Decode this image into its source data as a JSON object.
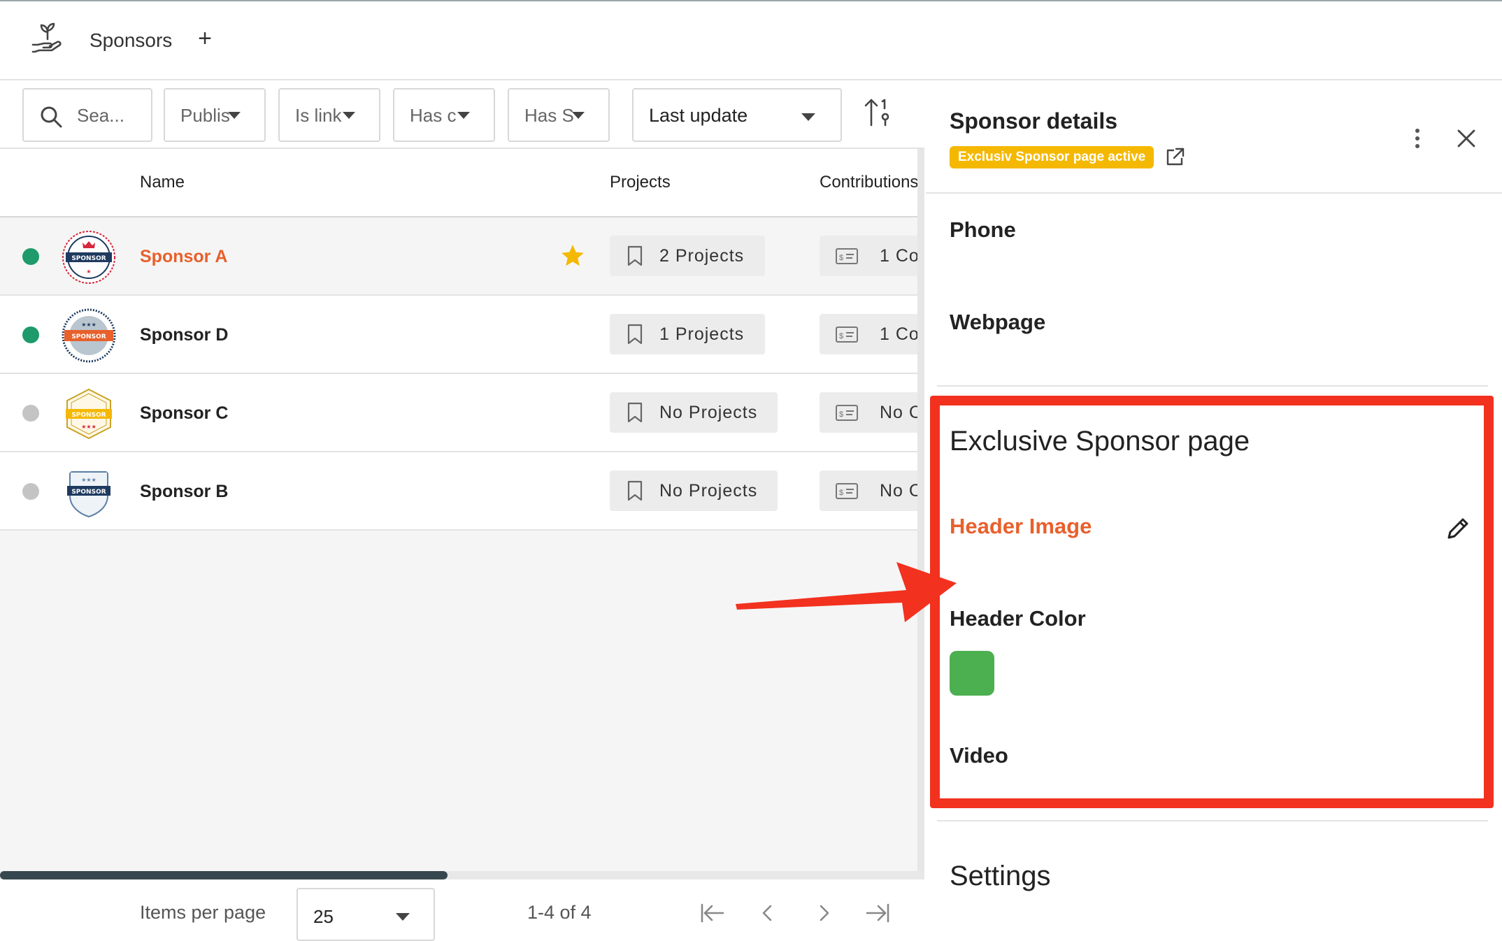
{
  "header": {
    "title": "Sponsors",
    "add_label": "+"
  },
  "filters": {
    "search_placeholder": "Sea...",
    "published": "Publis",
    "is_linked": "Is link",
    "has_c": "Has c",
    "has_s": "Has S",
    "sort_label": "Last update"
  },
  "table": {
    "columns": [
      "Name",
      "Projects",
      "Contributions"
    ],
    "rows": [
      {
        "name": "Sponsor A",
        "status_color": "#1f9a6b",
        "projects": "2 Projects",
        "contributions": "1 Co",
        "favorite": true,
        "selected": true
      },
      {
        "name": "Sponsor D",
        "status_color": "#1f9a6b",
        "projects": "1 Projects",
        "contributions": "1 Co",
        "favorite": false,
        "selected": false
      },
      {
        "name": "Sponsor C",
        "status_color": "#c4c4c4",
        "projects": "No Projects",
        "contributions": "No C",
        "favorite": false,
        "selected": false
      },
      {
        "name": "Sponsor B",
        "status_color": "#c4c4c4",
        "projects": "No Projects",
        "contributions": "No C",
        "favorite": false,
        "selected": false
      }
    ],
    "logo_text": "SPONSOR"
  },
  "pagination": {
    "items_per_page_label": "Items per page",
    "items_per_page": "25",
    "range": "1-4 of 4"
  },
  "details": {
    "title": "Sponsor details",
    "badge": "Exclusiv Sponsor page active",
    "phone_label": "Phone",
    "webpage_label": "Webpage",
    "exclusive_title": "Exclusive Sponsor page",
    "header_image_label": "Header Image",
    "header_color_label": "Header Color",
    "header_color": "#4caf50",
    "video_label": "Video",
    "settings_title": "Settings"
  },
  "colors": {
    "accent_orange": "#e8602c",
    "badge_yellow": "#f5b800",
    "highlight_red": "#f2311f",
    "status_green": "#1f9a6b",
    "status_gray": "#c4c4c4"
  },
  "icons": {
    "app": "hand-plant-icon",
    "search": "search-icon",
    "sort_direction": "sort-direction-icon",
    "favorite": "star-icon",
    "projects": "bookmark-icon",
    "contributions": "payment-icon",
    "external": "external-link-icon",
    "more": "more-vertical-icon",
    "close": "close-icon",
    "edit": "pencil-icon"
  }
}
